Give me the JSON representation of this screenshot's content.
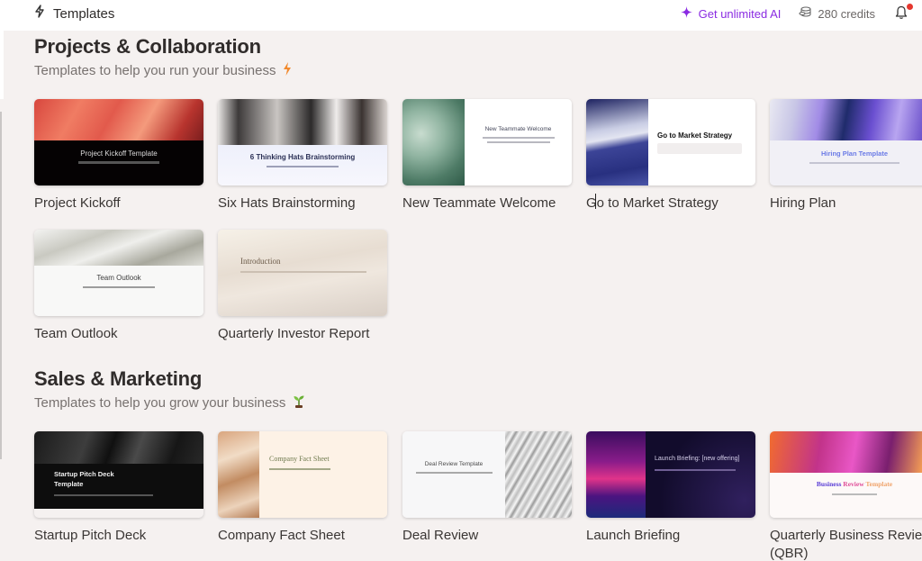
{
  "topbar": {
    "title": "Templates",
    "title_icon": "lightning-icon",
    "ai_label": "Get unlimited AI",
    "ai_icon": "sparkle-icon",
    "credits_label": "280 credits",
    "credits_icon": "coins-icon",
    "notifications_icon": "bell-icon",
    "notification_badge": true
  },
  "colors": {
    "accent": "#8a2be2",
    "badge": "#e5372e",
    "background": "#f5f1f0"
  },
  "sections": [
    {
      "title": "Projects & Collaboration",
      "subtitle": "Templates to help you run your business",
      "emoji": "⚡",
      "templates": [
        {
          "label": "Project Kickoff",
          "thumb_title": "Project Kickoff Template"
        },
        {
          "label": "Six Hats Brainstorming",
          "thumb_title": "6 Thinking Hats Brainstorming"
        },
        {
          "label": "New Teammate Welcome",
          "thumb_title": "New Teammate Welcome"
        },
        {
          "label": "Go to Market Strategy",
          "thumb_title": "Go to Market Strategy"
        },
        {
          "label": "Hiring Plan",
          "thumb_title": "Hiring Plan Template"
        },
        {
          "label": "Team Outlook",
          "thumb_title": "Team Outlook"
        },
        {
          "label": "Quarterly Investor Report",
          "thumb_title": "Introduction"
        }
      ]
    },
    {
      "title": "Sales & Marketing",
      "subtitle": "Templates to help you grow your business",
      "emoji": "🌱",
      "templates": [
        {
          "label": "Startup Pitch Deck",
          "thumb_title": "Startup Pitch Deck Template"
        },
        {
          "label": "Company Fact Sheet",
          "thumb_title": "Company Fact Sheet"
        },
        {
          "label": "Deal Review",
          "thumb_title": "Deal Review Template"
        },
        {
          "label": "Launch Briefing",
          "thumb_title": "Launch Briefing: [new offering]"
        },
        {
          "label": "Quarterly Business Review (QBR)",
          "thumb_title_parts": [
            "Business",
            "Review",
            "Template"
          ]
        }
      ]
    }
  ]
}
